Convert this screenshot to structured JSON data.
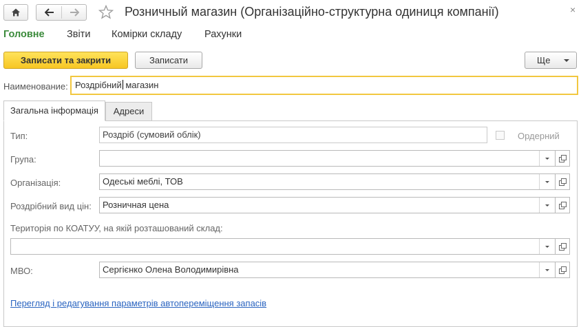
{
  "window": {
    "title": "Розничный магазин (Організаційно-структурна одиниця компанії)",
    "close_glyph": "×"
  },
  "sections": [
    {
      "label": "Головне",
      "active": true
    },
    {
      "label": "Звіти"
    },
    {
      "label": "Комірки складу"
    },
    {
      "label": "Рахунки"
    }
  ],
  "toolbar": {
    "save_close_label": "Записати та закрити",
    "save_label": "Записати",
    "more_label": "Ще"
  },
  "name": {
    "label": "Наименование:",
    "value_before_cursor": "Роздрібний",
    "value_after_cursor": " магазин"
  },
  "tabs": [
    {
      "label": "Загальна інформація",
      "active": true
    },
    {
      "label": "Адреси"
    }
  ],
  "form": {
    "type": {
      "label": "Тип:",
      "value": "Роздріб (сумовий облік)"
    },
    "orderly": {
      "label": "Ордерний",
      "checked": false
    },
    "group": {
      "label": "Група:",
      "value": ""
    },
    "organization": {
      "label": "Організація:",
      "value": "Одеські меблі, ТОВ"
    },
    "price_type": {
      "label": "Роздрібний вид цін:",
      "value": "Розничная цена"
    },
    "koatuu": {
      "label": "Територія по КОАТУУ, на якій розташований склад:",
      "value": ""
    },
    "mvo": {
      "label": "МВО:",
      "value": "Сергієнко Олена Володимирівна"
    }
  },
  "link": {
    "label": "Перегляд і редагування параметрів автопереміщення запасів"
  },
  "colors": {
    "accent_green": "#3a8a3a",
    "primary_button": "#f7c623",
    "focus_border": "#f2c73f",
    "link": "#2a64c0"
  }
}
